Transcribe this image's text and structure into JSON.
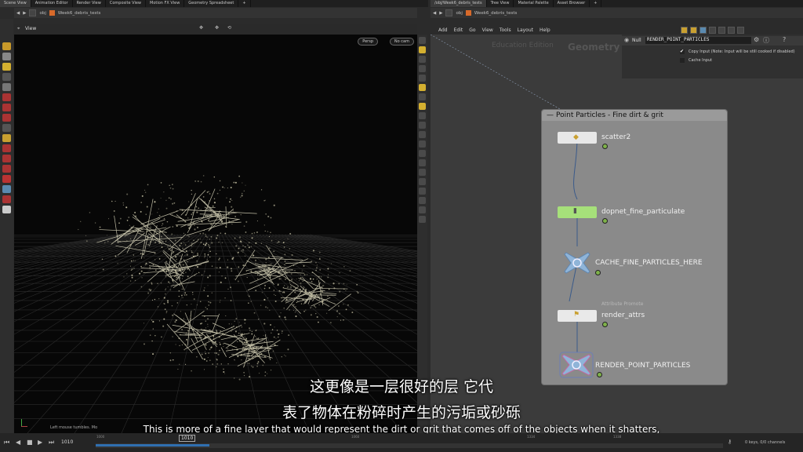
{
  "top_tabs_left": [
    "Scene View",
    "Animation Editor",
    "Render View",
    "Composite View",
    "Motion FX View",
    "Geometry Spreadsheet",
    "+"
  ],
  "top_tabs_right": [
    "/obj/Week6_debris_tests",
    "Tree View",
    "Material Palette",
    "Asset Browser",
    "+"
  ],
  "path_left": {
    "context": "obj",
    "file": "Week6_debris_tests"
  },
  "path_right": {
    "context": "obj",
    "file": "Week6_debris_tests"
  },
  "viewport": {
    "title": "View",
    "persp": "Persp",
    "cam": "No cam",
    "status": "Left mouse tumbles. Mo"
  },
  "network_menu": [
    "Add",
    "Edit",
    "Go",
    "View",
    "Tools",
    "Layout",
    "Help"
  ],
  "network_watermark": {
    "edition": "Education Edition",
    "context": "Geometry"
  },
  "param_panel": {
    "node_type": "Null",
    "node_name": "RENDER_POINT_PARTICLES",
    "copy_input": "Copy Input (Note: Input will be still cooked if disabled)",
    "cache_input": "Cache Input"
  },
  "netbox": {
    "title": "Point Particles - Fine dirt & grit"
  },
  "nodes": [
    {
      "name": "scatter2"
    },
    {
      "name": "dopnet_fine_particulate"
    },
    {
      "name": "CACHE_FINE_PARTICLES_HERE"
    },
    {
      "name": "render_attrs",
      "sub": "Attribute Promote"
    },
    {
      "name": "RENDER_POINT_PARTICLES"
    }
  ],
  "timeline": {
    "frame": "1010",
    "marker": "1010",
    "tick_a": "1000",
    "tick_b": "1060",
    "tick_c": "1334",
    "tick_d": "1338",
    "keys": "0 keys, 0/0 channels"
  },
  "subtitles": {
    "zh_line1": "这更像是一层很好的层 它代",
    "zh_line2": "表了物体在粉碎时产生的污垢或砂砾",
    "en": "This is more of a fine layer that would represent the dirt or grit that comes off of the objects when it shatters,"
  },
  "colors": {
    "accent": "#f0a020",
    "node_green": "#a6e07a",
    "null_blue": "#7fa8d0",
    "particle": "#d6d2b8"
  }
}
